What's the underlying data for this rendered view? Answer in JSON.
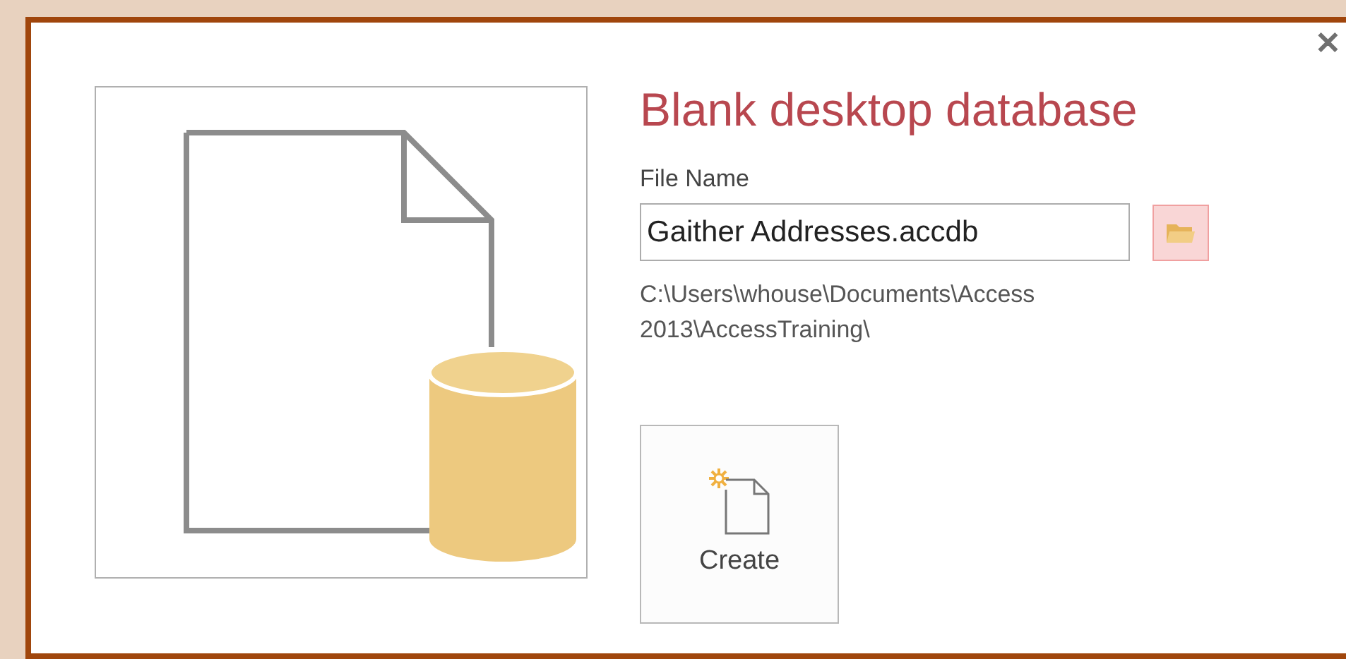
{
  "dialog": {
    "close_button": "✕",
    "title": "Blank desktop database",
    "file_name": {
      "label": "File Name",
      "value": "Gaither Addresses.accdb"
    },
    "path": "C:\\Users\\whouse\\Documents\\Access 2013\\AccessTraining\\",
    "create_button": {
      "label": "Create"
    }
  }
}
